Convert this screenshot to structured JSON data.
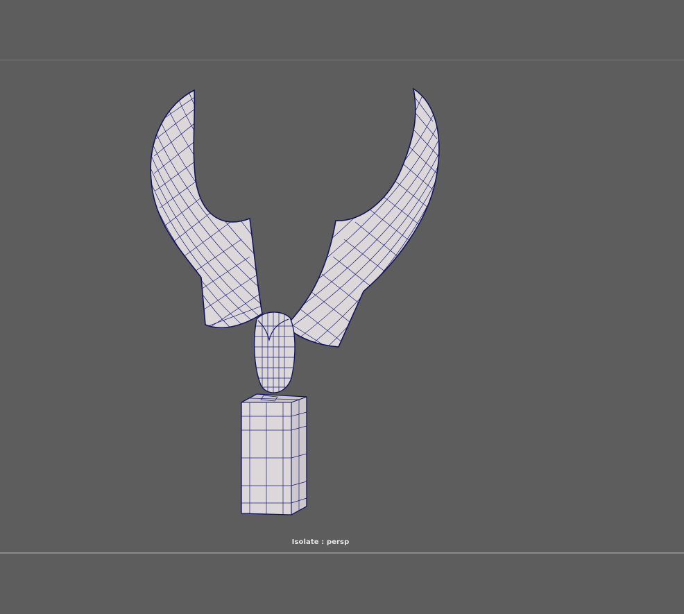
{
  "viewport": {
    "hud_label": "Isolate : persp",
    "camera": "persp",
    "mode": "isolate-select",
    "display": "wireframe-on-shaded"
  },
  "colors": {
    "background": "#5d5d5d",
    "mesh_fill": "#dcd8da",
    "wire": "#1c1c7a",
    "hud_text": "#e6e6e6"
  }
}
